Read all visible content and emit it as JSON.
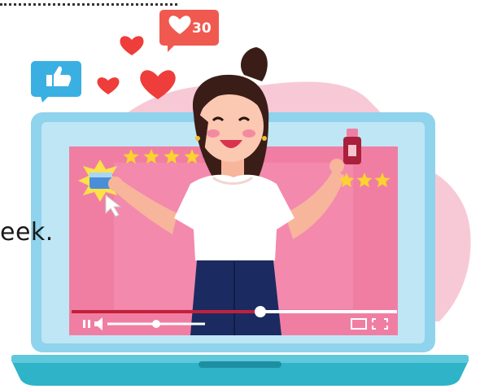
{
  "page_text": {
    "partial_word": "eek."
  },
  "notification": {
    "icon": "heart-icon",
    "count": "30"
  },
  "reaction_icons": [
    "thumbs-up-icon",
    "heart-icon"
  ],
  "video_player": {
    "progress": 0.58,
    "volume": 0.5,
    "rating_left_stars": 4,
    "rating_right_stars": 3
  },
  "colors": {
    "blob_pink": "#f7c9d6",
    "screen_pink": "#f07ea3",
    "laptop_frame": "#8fd3ec",
    "laptop_base": "#2eb3c9",
    "heart_red": "#ee3d3a",
    "badge_red": "#f0594f",
    "like_blue": "#3ab0e2",
    "star_yellow": "#fcd32e",
    "hair": "#3b1d17",
    "pants": "#1b2b61"
  }
}
